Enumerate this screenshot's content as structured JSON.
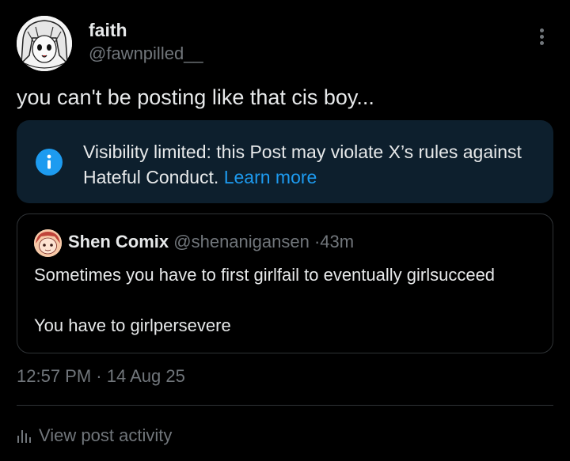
{
  "post": {
    "author_name": "faith",
    "author_handle": "@fawnpilled__",
    "text": "you can't be posting like that cis boy...",
    "time": "12:57 PM",
    "date": "14 Aug 25",
    "meta_separator": "·"
  },
  "notice": {
    "text": "Visibility limited: this Post may violate X’s rules against Hateful Conduct.",
    "link_label": "Learn more",
    "icon": "info-icon",
    "accent": "#1d9bf0"
  },
  "quote": {
    "author_name": "Shen Comix",
    "author_handle": "@shenanigansen",
    "separator": "·",
    "time": "43m",
    "line1": "Sometimes you have to first girlfail to eventually girlsucceed",
    "line2": "You have to girlpersevere"
  },
  "footer": {
    "activity_label": "View post activity",
    "icon": "bar-chart-icon"
  },
  "colors": {
    "background": "#000000",
    "text": "#e7e9ea",
    "muted": "#71767b",
    "link": "#1d9bf0",
    "notice_bg": "#0d1f2d",
    "border": "#2f3336"
  }
}
